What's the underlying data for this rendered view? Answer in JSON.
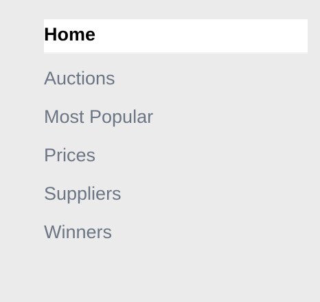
{
  "nav": {
    "items": [
      {
        "label": "Home",
        "active": true
      },
      {
        "label": "Auctions",
        "active": false
      },
      {
        "label": "Most Popular",
        "active": false
      },
      {
        "label": "Prices",
        "active": false
      },
      {
        "label": "Suppliers",
        "active": false
      },
      {
        "label": "Winners",
        "active": false
      }
    ]
  },
  "colors": {
    "page_background": "#ebebeb",
    "active_item_background": "#ffffff",
    "active_text": "#000000",
    "inactive_text": "#6b7584"
  }
}
